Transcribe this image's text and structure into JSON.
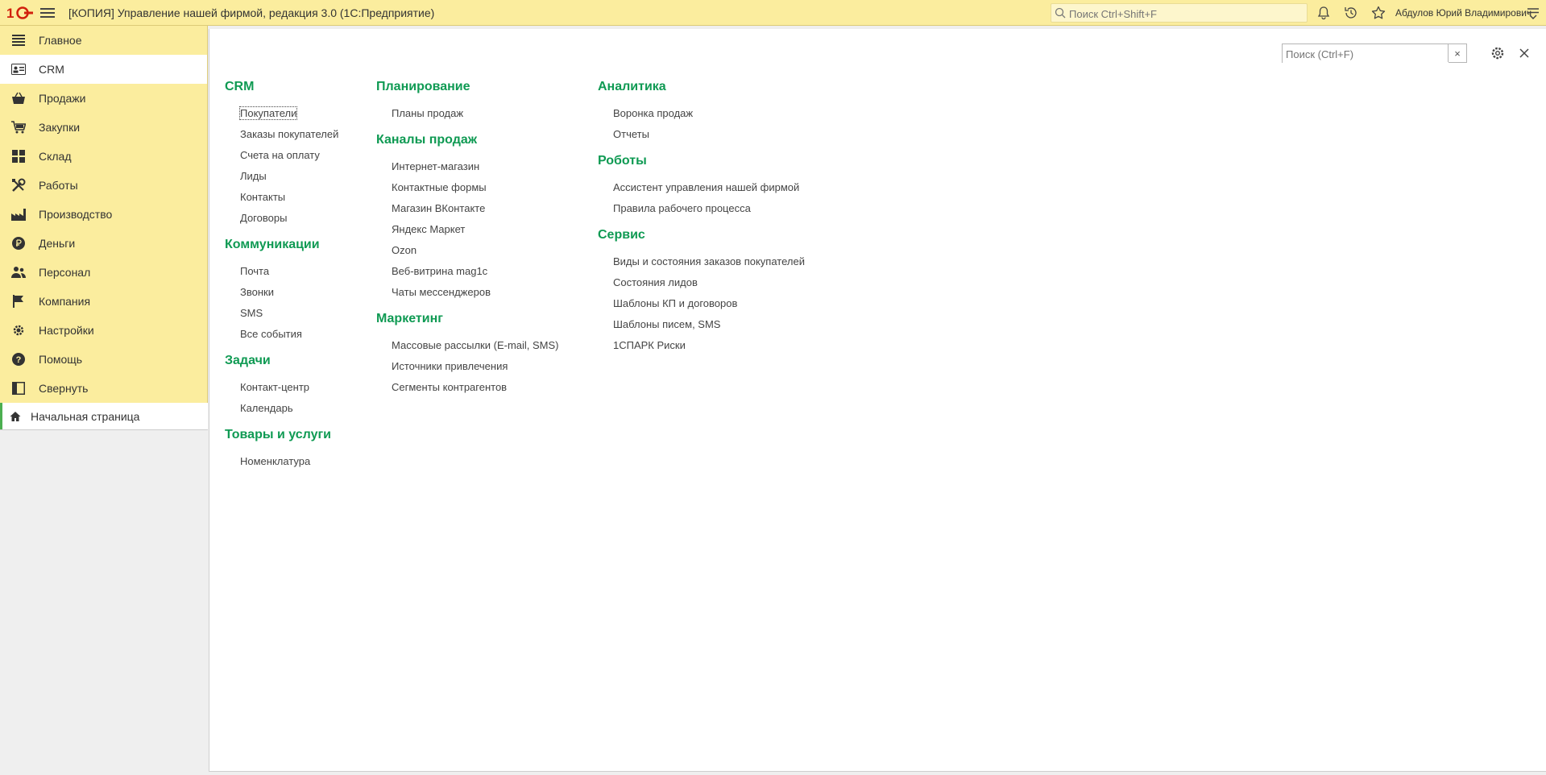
{
  "titlebar": {
    "app_title": "[КОПИЯ] Управление нашей фирмой, редакция 3.0  (1С:Предприятие)",
    "search_placeholder": "Поиск Ctrl+Shift+F",
    "user_name": "Абдулов Юрий Владимирович"
  },
  "sidebar": {
    "items": [
      {
        "label": "Главное",
        "icon": "menu-lines-icon"
      },
      {
        "label": "CRM",
        "icon": "contact-card-icon"
      },
      {
        "label": "Продажи",
        "icon": "basket-icon"
      },
      {
        "label": "Закупки",
        "icon": "cart-icon"
      },
      {
        "label": "Склад",
        "icon": "warehouse-grid-icon"
      },
      {
        "label": "Работы",
        "icon": "tools-icon"
      },
      {
        "label": "Производство",
        "icon": "factory-icon"
      },
      {
        "label": "Деньги",
        "icon": "ruble-icon"
      },
      {
        "label": "Персонал",
        "icon": "people-icon"
      },
      {
        "label": "Компания",
        "icon": "flag-icon"
      },
      {
        "label": "Настройки",
        "icon": "gear-icon"
      },
      {
        "label": "Помощь",
        "icon": "help-icon"
      },
      {
        "label": "Свернуть",
        "icon": "collapse-icon"
      }
    ],
    "home_tab": "Начальная страница"
  },
  "panel": {
    "search_placeholder": "Поиск (Ctrl+F)",
    "clear_label": "×",
    "columns": [
      {
        "groups": [
          {
            "title": "CRM",
            "links": [
              "Покупатели",
              "Заказы покупателей",
              "Счета на оплату",
              "Лиды",
              "Контакты",
              "Договоры"
            ]
          },
          {
            "title": "Коммуникации",
            "links": [
              "Почта",
              "Звонки",
              "SMS",
              "Все события"
            ]
          },
          {
            "title": "Задачи",
            "links": [
              "Контакт-центр",
              "Календарь"
            ]
          },
          {
            "title": "Товары и услуги",
            "links": [
              "Номенклатура"
            ]
          }
        ]
      },
      {
        "groups": [
          {
            "title": "Планирование",
            "links": [
              "Планы продаж"
            ]
          },
          {
            "title": "Каналы продаж",
            "links": [
              "Интернет-магазин",
              "Контактные формы",
              "Магазин ВКонтакте",
              "Яндекс Маркет",
              "Ozon",
              "Веб-витрина mag1c",
              "Чаты мессенджеров"
            ]
          },
          {
            "title": "Маркетинг",
            "links": [
              "Массовые рассылки (E-mail, SMS)",
              "Источники привлечения",
              "Сегменты контрагентов"
            ]
          }
        ]
      },
      {
        "groups": [
          {
            "title": "Аналитика",
            "links": [
              "Воронка продаж",
              "Отчеты"
            ]
          },
          {
            "title": "Роботы",
            "links": [
              "Ассистент управления нашей фирмой",
              "Правила рабочего процесса"
            ]
          },
          {
            "title": "Сервис",
            "links": [
              "Виды и состояния заказов покупателей",
              "Состояния лидов",
              "Шаблоны КП и договоров",
              "Шаблоны писем, SMS",
              "1СПАРК Риски"
            ]
          }
        ]
      }
    ]
  },
  "colors": {
    "chrome_yellow": "#fbed9e",
    "group_title_green": "#0f9a53",
    "logo_red": "#d1200d"
  }
}
